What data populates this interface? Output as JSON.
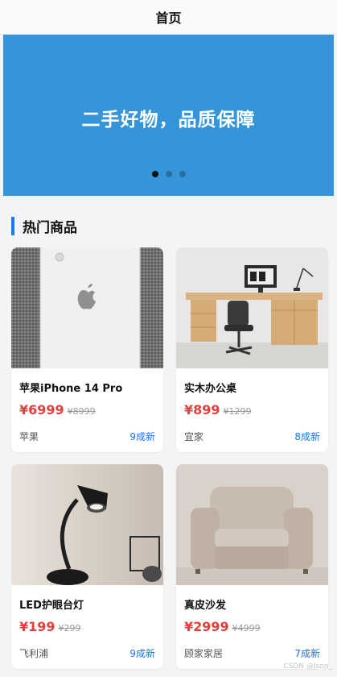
{
  "header": {
    "title": "首页"
  },
  "banner": {
    "slogan": "二手好物，品质保障",
    "slide_count": 3,
    "active_index": 0,
    "color": "#3495d9"
  },
  "section": {
    "title": "热门商品"
  },
  "products": [
    {
      "name": "苹果iPhone 14 Pro",
      "price": "¥6999",
      "original_price": "¥8999",
      "brand": "苹果",
      "condition": "9成新",
      "image_icon": "iphone-back-photo"
    },
    {
      "name": "实木办公桌",
      "price": "¥899",
      "original_price": "¥1299",
      "brand": "宜家",
      "condition": "8成新",
      "image_icon": "office-desk-photo"
    },
    {
      "name": "LED护眼台灯",
      "price": "¥199",
      "original_price": "¥299",
      "brand": "飞利浦",
      "condition": "9成新",
      "image_icon": "desk-lamp-photo"
    },
    {
      "name": "真皮沙发",
      "price": "¥2999",
      "original_price": "¥4999",
      "brand": "顾家家居",
      "condition": "7成新",
      "image_icon": "armchair-photo"
    }
  ],
  "watermark": "CSDN @Json_",
  "colors": {
    "accent": "#1877f2",
    "price": "#e3403d",
    "banner": "#3495d9"
  }
}
